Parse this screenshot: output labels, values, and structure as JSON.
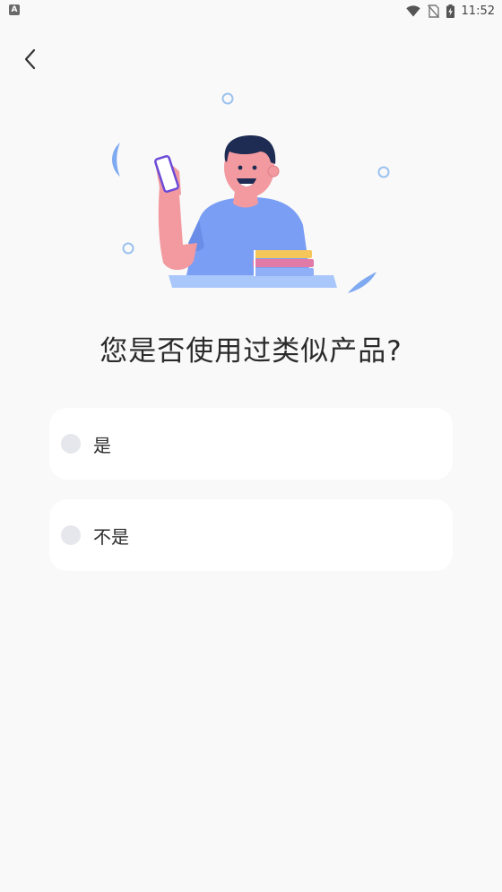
{
  "status_bar": {
    "left_icon": "A",
    "time": "11:52",
    "icons": [
      "wifi-icon",
      "no-sim-icon",
      "battery-charging-icon"
    ]
  },
  "nav": {
    "back_icon": "chevron-left-icon"
  },
  "illustration": {
    "description_icon": "person-holding-phone-illustration",
    "colors": {
      "shirt": "#7b9ef5",
      "skin": "#f29a9f",
      "hair": "#1e2b52",
      "desk": "#a9c7fb",
      "book_yellow": "#f5c65a",
      "book_pink": "#e27aa7",
      "book_blue": "#8fb0f7",
      "bubble": "#9cc2ee"
    }
  },
  "question": {
    "title": "您是否使用过类似产品?"
  },
  "options": [
    {
      "label": "是",
      "selected": false
    },
    {
      "label": "不是",
      "selected": false
    }
  ],
  "colors": {
    "background": "#f9f9f9",
    "card": "#ffffff",
    "radio_unselected": "#e6e7ec",
    "text": "#2b2b2b"
  }
}
